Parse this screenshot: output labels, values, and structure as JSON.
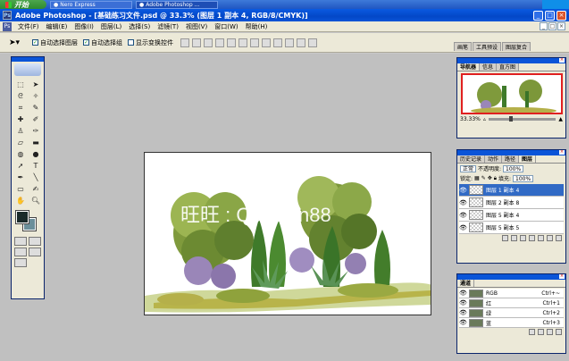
{
  "taskbar": {
    "start_label": "开始",
    "tasks": [
      {
        "label": "Nero Express",
        "active": false
      },
      {
        "label": "Adobe Photoshop ...",
        "active": true
      }
    ]
  },
  "titlebar": {
    "title": "Adobe Photoshop - [基础练习文件.psd @ 33.3% (图层 1 副本 4, RGB/8/CMYK)]"
  },
  "menubar": {
    "items": [
      "文件(F)",
      "编辑(E)",
      "图像(I)",
      "图层(L)",
      "选择(S)",
      "滤镜(T)",
      "视图(V)",
      "窗口(W)",
      "帮助(H)"
    ]
  },
  "options": {
    "auto_select_layer": "自动选择图层",
    "auto_select_group": "自动选择组",
    "show_transform": "显示变换控件"
  },
  "palette_well": {
    "tabs": [
      "画笔",
      "工具预设",
      "图层复合"
    ]
  },
  "canvas": {
    "watermark_top": "旺旺   . . .",
    "watermark_main": "旺旺 : Qcaobin88"
  },
  "navigator": {
    "tabs": [
      "导航器",
      "信息",
      "直方图"
    ],
    "zoom": "33.33%"
  },
  "layers_panel": {
    "tabs": [
      "历史记录",
      "动作",
      "路径",
      "图层"
    ],
    "blend_mode": "正常",
    "opacity_label": "不透明度:",
    "opacity_value": "100%",
    "lock_label": "锁定:",
    "fill_label": "填充:",
    "fill_value": "100%",
    "layers": [
      {
        "name": "图层 1 副本 4",
        "selected": true
      },
      {
        "name": "图层 2 副本 8",
        "selected": false
      },
      {
        "name": "图层 5 副本 4",
        "selected": false
      },
      {
        "name": "图层 5 副本 5",
        "selected": false
      }
    ]
  },
  "channels_panel": {
    "tab": "通道",
    "channels": [
      {
        "name": "RGB",
        "shortcut": "Ctrl+~"
      },
      {
        "name": "红",
        "shortcut": "Ctrl+1"
      },
      {
        "name": "绿",
        "shortcut": "Ctrl+2"
      },
      {
        "name": "蓝",
        "shortcut": "Ctrl+3"
      }
    ]
  },
  "colors": {
    "foreground": "#1a2a2a",
    "background": "#6b8f9a",
    "title_blue": "#0a54d8",
    "selection": "#316ac5"
  }
}
